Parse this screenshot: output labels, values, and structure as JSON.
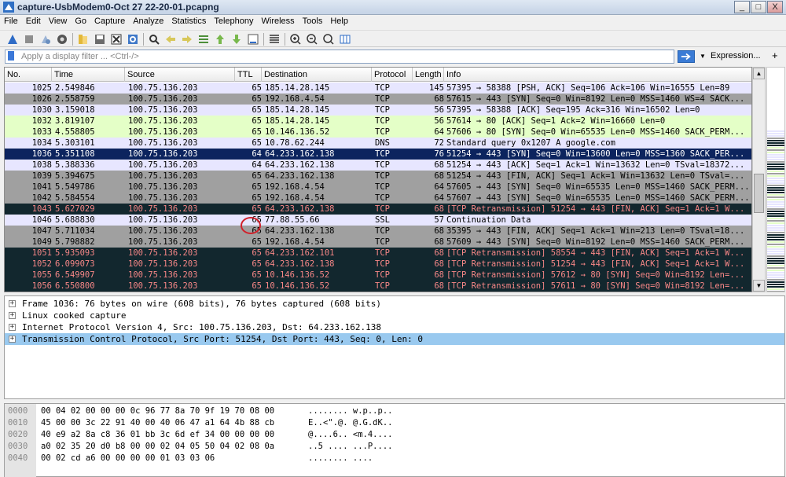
{
  "window": {
    "title": "capture-UsbModem0-Oct 27 22-20-01.pcapng",
    "min_label": "_",
    "max_label": "□",
    "close_label": "X"
  },
  "menu": [
    "File",
    "Edit",
    "View",
    "Go",
    "Capture",
    "Analyze",
    "Statistics",
    "Telephony",
    "Wireless",
    "Tools",
    "Help"
  ],
  "filter": {
    "placeholder": "Apply a display filter ... <Ctrl-/>",
    "expression_label": "Expression...",
    "plus_label": "+"
  },
  "columns": [
    "No.",
    "Time",
    "Source",
    "TTL",
    "Destination",
    "Protocol",
    "Length",
    "Info"
  ],
  "colors": {
    "lavender": "#e7e6ff",
    "green": "#e4ffc7",
    "gray": "#a0a0a0",
    "dark": "#12272e",
    "dark_text": "#f78787",
    "selected": "#0c245e",
    "accent": "#3a7bd5"
  },
  "packets": [
    {
      "no": "1025",
      "time": "2.549846",
      "src": "100.75.136.203",
      "ttl": "65",
      "dst": "185.14.28.145",
      "proto": "TCP",
      "len": "145",
      "info": "57395 → 58388 [PSH, ACK] Seq=106 Ack=106 Win=16555 Len=89",
      "style": "lavender"
    },
    {
      "no": "1026",
      "time": "2.558759",
      "src": "100.75.136.203",
      "ttl": "65",
      "dst": "192.168.4.54",
      "proto": "TCP",
      "len": "68",
      "info": "57615 → 443 [SYN] Seq=0 Win=8192 Len=0 MSS=1460 WS=4 SACK...",
      "style": "gray"
    },
    {
      "no": "1030",
      "time": "3.159018",
      "src": "100.75.136.203",
      "ttl": "65",
      "dst": "185.14.28.145",
      "proto": "TCP",
      "len": "56",
      "info": "57395 → 58388 [ACK] Seq=195 Ack=316 Win=16502 Len=0",
      "style": "lavender"
    },
    {
      "no": "1032",
      "time": "3.819107",
      "src": "100.75.136.203",
      "ttl": "65",
      "dst": "185.14.28.145",
      "proto": "TCP",
      "len": "56",
      "info": "57614 → 80 [ACK] Seq=1 Ack=2 Win=16660 Len=0",
      "style": "green"
    },
    {
      "no": "1033",
      "time": "4.558805",
      "src": "100.75.136.203",
      "ttl": "65",
      "dst": "10.146.136.52",
      "proto": "TCP",
      "len": "64",
      "info": "57606 → 80 [SYN] Seq=0 Win=65535 Len=0 MSS=1460 SACK_PERM...",
      "style": "green"
    },
    {
      "no": "1034",
      "time": "5.303101",
      "src": "100.75.136.203",
      "ttl": "65",
      "dst": "10.78.62.244",
      "proto": "DNS",
      "len": "72",
      "info": "Standard query 0x1207 A google.com",
      "style": "lavender"
    },
    {
      "no": "1036",
      "time": "5.351108",
      "src": "100.75.136.203",
      "ttl": "64",
      "dst": "64.233.162.138",
      "proto": "TCP",
      "len": "76",
      "info": "51254 → 443 [SYN] Seq=0 Win=13600 Len=0 MSS=1360 SACK_PER...",
      "style": "selected"
    },
    {
      "no": "1038",
      "time": "5.388336",
      "src": "100.75.136.203",
      "ttl": "64",
      "dst": "64.233.162.138",
      "proto": "TCP",
      "len": "68",
      "info": "51254 → 443 [ACK] Seq=1 Ack=1 Win=13632 Len=0 TSval=18372...",
      "style": "lavender"
    },
    {
      "no": "1039",
      "time": "5.394675",
      "src": "100.75.136.203",
      "ttl": "65",
      "dst": "64.233.162.138",
      "proto": "TCP",
      "len": "68",
      "info": "51254 → 443 [FIN, ACK] Seq=1 Ack=1 Win=13632 Len=0 TSval=...",
      "style": "gray"
    },
    {
      "no": "1041",
      "time": "5.549786",
      "src": "100.75.136.203",
      "ttl": "65",
      "dst": "192.168.4.54",
      "proto": "TCP",
      "len": "64",
      "info": "57605 → 443 [SYN] Seq=0 Win=65535 Len=0 MSS=1460 SACK_PERM...",
      "style": "gray"
    },
    {
      "no": "1042",
      "time": "5.584554",
      "src": "100.75.136.203",
      "ttl": "65",
      "dst": "192.168.4.54",
      "proto": "TCP",
      "len": "64",
      "info": "57607 → 443 [SYN] Seq=0 Win=65535 Len=0 MSS=1460 SACK_PERM...",
      "style": "gray"
    },
    {
      "no": "1043",
      "time": "5.627029",
      "src": "100.75.136.203",
      "ttl": "65",
      "dst": "64.233.162.138",
      "proto": "TCP",
      "len": "68",
      "info": "[TCP Retransmission] 51254 → 443 [FIN, ACK] Seq=1 Ack=1 W...",
      "style": "dark"
    },
    {
      "no": "1046",
      "time": "5.688830",
      "src": "100.75.136.203",
      "ttl": "65",
      "dst": "77.88.55.66",
      "proto": "SSL",
      "len": "57",
      "info": "Continuation Data",
      "style": "lavender"
    },
    {
      "no": "1047",
      "time": "5.711034",
      "src": "100.75.136.203",
      "ttl": "65",
      "dst": "64.233.162.138",
      "proto": "TCP",
      "len": "68",
      "info": "35395 → 443 [FIN, ACK] Seq=1 Ack=1 Win=213 Len=0 TSval=18...",
      "style": "gray"
    },
    {
      "no": "1049",
      "time": "5.798882",
      "src": "100.75.136.203",
      "ttl": "65",
      "dst": "192.168.4.54",
      "proto": "TCP",
      "len": "68",
      "info": "57609 → 443 [SYN] Seq=0 Win=8192 Len=0 MSS=1460 SACK_PERM...",
      "style": "gray"
    },
    {
      "no": "1051",
      "time": "5.935093",
      "src": "100.75.136.203",
      "ttl": "65",
      "dst": "64.233.162.101",
      "proto": "TCP",
      "len": "68",
      "info": "[TCP Retransmission] 58554 → 443 [FIN, ACK] Seq=1 Ack=1 W...",
      "style": "dark"
    },
    {
      "no": "1052",
      "time": "6.099073",
      "src": "100.75.136.203",
      "ttl": "65",
      "dst": "64.233.162.138",
      "proto": "TCP",
      "len": "68",
      "info": "[TCP Retransmission] 51254 → 443 [FIN, ACK] Seq=1 Ack=1 W...",
      "style": "dark"
    },
    {
      "no": "1055",
      "time": "6.549907",
      "src": "100.75.136.203",
      "ttl": "65",
      "dst": "10.146.136.52",
      "proto": "TCP",
      "len": "68",
      "info": "[TCP Retransmission] 57612 → 80 [SYN] Seq=0 Win=8192 Len=...",
      "style": "dark"
    },
    {
      "no": "1056",
      "time": "6.550800",
      "src": "100.75.136.203",
      "ttl": "65",
      "dst": "10.146.136.52",
      "proto": "TCP",
      "len": "68",
      "info": "[TCP Retransmission] 57611 → 80 [SYN] Seq=0 Win=8192 Len=...",
      "style": "dark"
    }
  ],
  "details": [
    {
      "text": "Frame 1036: 76 bytes on wire (608 bits), 76 bytes captured (608 bits)",
      "selected": false
    },
    {
      "text": "Linux cooked capture",
      "selected": false
    },
    {
      "text": "Internet Protocol Version 4, Src: 100.75.136.203, Dst: 64.233.162.138",
      "selected": false
    },
    {
      "text": "Transmission Control Protocol, Src Port: 51254, Dst Port: 443, Seq: 0, Len: 0",
      "selected": true
    }
  ],
  "expand_glyph": "+",
  "bytes": [
    {
      "offset": "0000",
      "hex": "00 04 02 00 00 00 0c 96  77 8a 70 9f 19 70 08 00",
      "ascii": "........ w.p..p.."
    },
    {
      "offset": "0010",
      "hex": "45 00 00 3c 22 91 40 00  40 06 47 a1 64 4b 88 cb",
      "ascii": "E..<\".@. @.G.dK.."
    },
    {
      "offset": "0020",
      "hex": "40 e9 a2 8a c8 36 01 bb  3c 6d ef 34 00 00 00 00",
      "ascii": "@....6.. <m.4...."
    },
    {
      "offset": "0030",
      "hex": "a0 02 35 20 d0 b8 00 00  02 04 05 50 04 02 08 0a",
      "ascii": "..5 .... ...P...."
    },
    {
      "offset": "0040",
      "hex": "00 02 cd a6 00 00 00 00  01 03 03 06",
      "ascii": "........ ...."
    }
  ]
}
